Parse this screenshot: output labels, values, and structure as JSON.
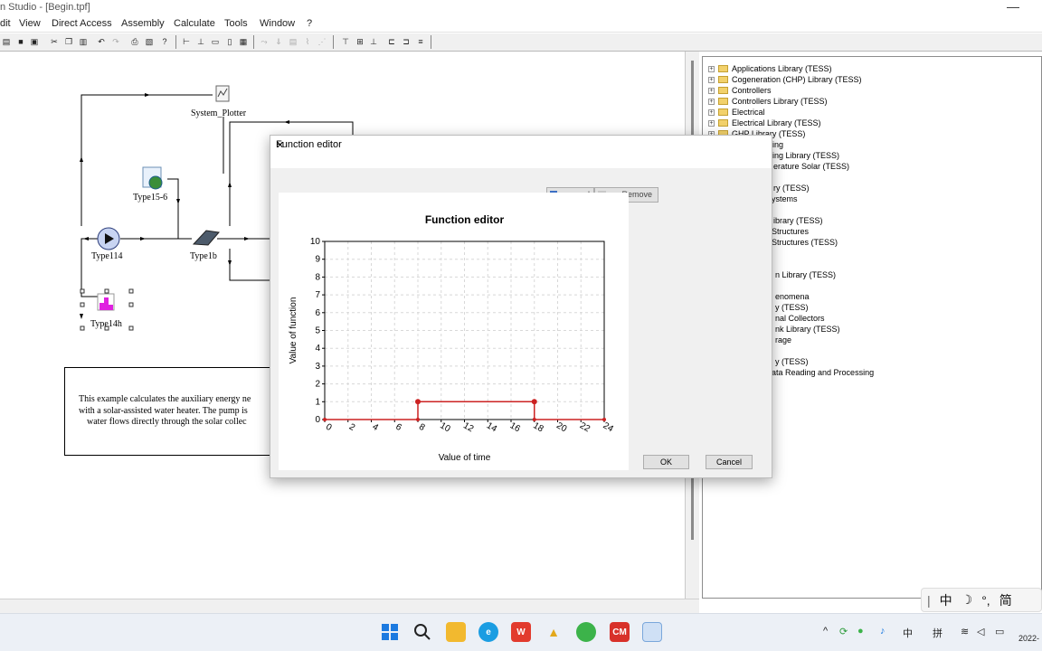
{
  "window": {
    "title": "n Studio - [Begin.tpf]",
    "minimize": "—"
  },
  "menu": [
    "dit",
    "View",
    "Direct Access",
    "Assembly",
    "Calculate",
    "Tools",
    "Window",
    "?"
  ],
  "canvas": {
    "components": {
      "plotter": "System_Plotter",
      "type15": "Type15-6",
      "pump": "Type114",
      "collector": "Type1b",
      "type14": "Type14h"
    },
    "description": [
      "This example calculates the auxiliary energy ne",
      "with a solar-assisted water heater.  The pump is",
      "water flows directly through the solar collec"
    ]
  },
  "library": {
    "items": [
      "Applications Library (TESS)",
      "Cogeneration (CHP) Library (TESS)",
      "Controllers",
      "Controllers Library (TESS)",
      "Electrical",
      "Electrical Library (TESS)",
      "GHP Library (TESS)"
    ],
    "partial_items": [
      "pling",
      "pling Library (TESS)",
      "erature Solar (TESS)",
      "ry (TESS)",
      "ystems",
      "ibrary (TESS)",
      "Structures",
      "Structures (TESS)",
      "n Library (TESS)",
      "enomena",
      "y (TESS)",
      "nal Collectors",
      "nk Library (TESS)",
      "rage",
      "y (TESS)",
      "ata Reading and Processing"
    ]
  },
  "dialog": {
    "title": "Function editor",
    "close": "✕",
    "add_button": "d",
    "remove_button": "Remove",
    "ok": "OK",
    "cancel": "Cancel"
  },
  "chart_data": {
    "type": "line",
    "title": "Function editor",
    "xlabel": "Value of time",
    "ylabel": "Value of function",
    "xlim": [
      0,
      24
    ],
    "ylim": [
      0,
      10
    ],
    "x_ticks": [
      0,
      2,
      4,
      6,
      8,
      10,
      12,
      14,
      16,
      18,
      20,
      22,
      24
    ],
    "y_ticks": [
      0,
      1,
      2,
      3,
      4,
      5,
      6,
      7,
      8,
      9,
      10
    ],
    "grid": true,
    "series": [
      {
        "x": [
          0,
          8,
          8,
          18,
          18,
          24
        ],
        "y": [
          0,
          0,
          1,
          1,
          0,
          0
        ]
      }
    ],
    "colors": {
      "line": "#cc2222",
      "grid": "#d8d8d8"
    }
  },
  "ime": [
    "中",
    "☽",
    "°,",
    "简"
  ],
  "tray": {
    "ime1": "中",
    "ime2": "拼",
    "clock": "2022-"
  }
}
